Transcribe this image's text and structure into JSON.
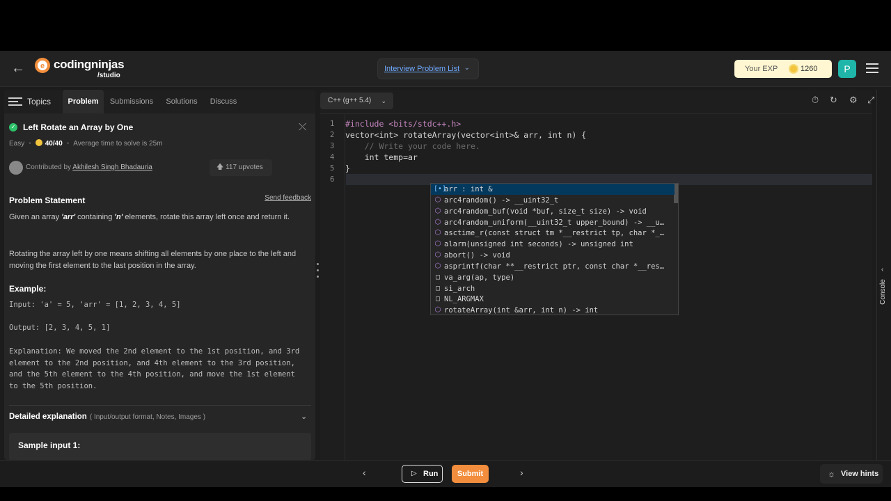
{
  "header": {
    "logo_name": "codingninjas",
    "logo_sub": "/studio",
    "interview_link": "Interview Problem List",
    "exp_label": "Your EXP",
    "exp_value": "1260",
    "avatar_letter": "P"
  },
  "tabs": [
    {
      "label": "Topics"
    },
    {
      "label": "Problem"
    },
    {
      "label": "Submissions"
    },
    {
      "label": "Solutions"
    },
    {
      "label": "Discuss"
    }
  ],
  "problem": {
    "title": "Left Rotate an Array by One",
    "difficulty": "Easy",
    "score": "40/40",
    "avg_time": "Average time to solve is 25m",
    "contributed_prefix": "Contributed by",
    "contributor": "Akhilesh Singh Bhadauria",
    "upvotes": "117 upvotes",
    "statement_heading": "Problem Statement",
    "send_feedback": "Send feedback",
    "para1_a": "Given an array ",
    "para1_b": "'arr'",
    "para1_c": " containing ",
    "para1_d": "'n'",
    "para1_e": " elements, rotate this array left once and return it.",
    "para2": "Rotating the array left by one means shifting all elements by one place to the left and moving the first element to the last position in the array.",
    "example_heading": "Example:",
    "example_input": "Input: 'a' = 5, 'arr' = [1, 2, 3, 4, 5]",
    "example_output": "Output: [2, 3, 4, 5, 1]",
    "example_explanation": "Explanation: We moved the 2nd element to the 1st position, and 3rd\nelement to the 2nd position, and 4th element to the 3rd position,\nand the 5th element to the 4th position, and move the 1st element\nto the 5th position.",
    "detailed_heading": "Detailed explanation",
    "detailed_sub": "( Input/output format, Notes, Images )",
    "sample_heading": "Sample input 1:"
  },
  "editor": {
    "language": "C++ (g++ 5.4)",
    "line_numbers": [
      "1",
      "2",
      "3",
      "4",
      "5",
      "6"
    ],
    "lines": [
      "#include <bits/stdc++.h>",
      "vector<int> rotateArray(vector<int>& arr, int n) {",
      "    // Write your code here.",
      "    int temp=ar",
      "}",
      ""
    ],
    "suggestions": [
      {
        "icon": "variable-icon",
        "text": "arr : int &"
      },
      {
        "icon": "method-icon",
        "text": "arc4random() -> __uint32_t"
      },
      {
        "icon": "method-icon",
        "text": "arc4random_buf(void *buf, size_t size) -> void"
      },
      {
        "icon": "method-icon",
        "text": "arc4random_uniform(__uint32_t upper_bound) -> __u…"
      },
      {
        "icon": "method-icon",
        "text": "asctime_r(const struct tm *__restrict tp, char *_…"
      },
      {
        "icon": "method-icon",
        "text": "alarm(unsigned int seconds) -> unsigned int"
      },
      {
        "icon": "method-icon",
        "text": "abort() -> void"
      },
      {
        "icon": "method-icon",
        "text": "asprintf(char **__restrict ptr, const char *__res…"
      },
      {
        "icon": "reference-icon",
        "text": "va_arg(ap, type)"
      },
      {
        "icon": "reference-icon",
        "text": "si_arch"
      },
      {
        "icon": "reference-icon",
        "text": "NL_ARGMAX"
      },
      {
        "icon": "method-icon",
        "text": "rotateArray(int &arr, int n) -> int"
      }
    ]
  },
  "console_label": "Console",
  "bottom": {
    "run_label": "Run",
    "submit_label": "Submit",
    "hints_label": "View hints"
  }
}
